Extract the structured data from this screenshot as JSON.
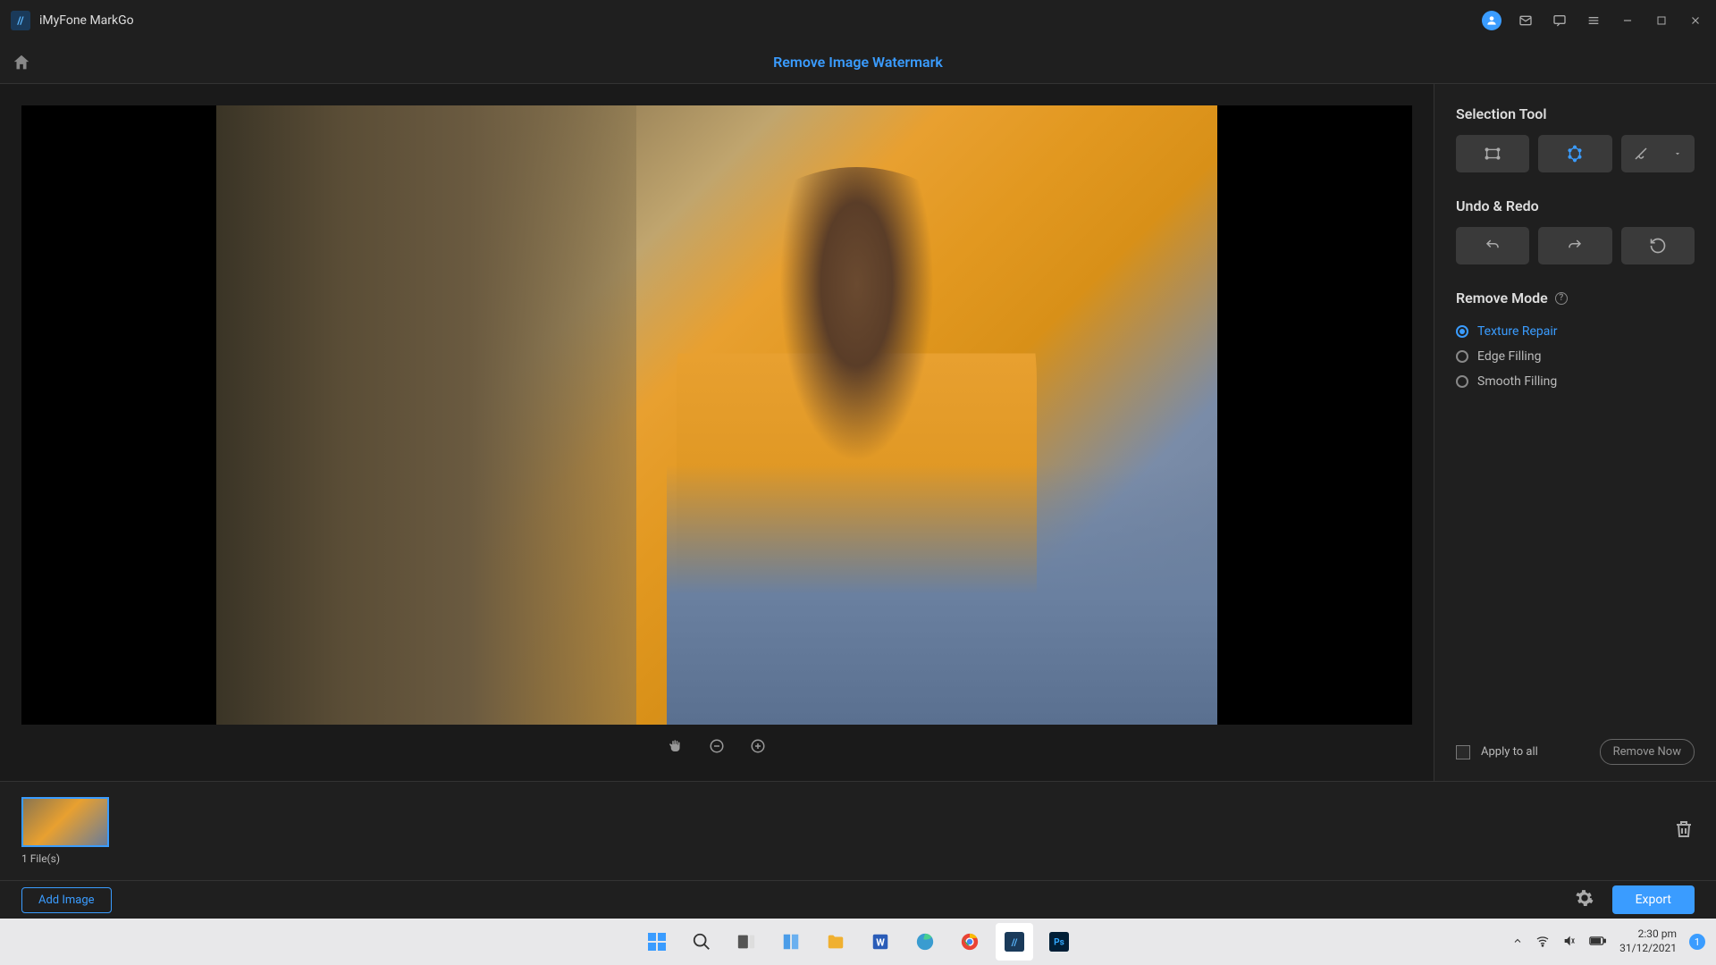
{
  "app": {
    "title": "iMyFone MarkGo"
  },
  "header": {
    "title": "Remove Image Watermark"
  },
  "panel": {
    "selection_title": "Selection Tool",
    "undo_title": "Undo & Redo",
    "remove_mode_title": "Remove Mode",
    "modes": [
      {
        "label": "Texture Repair",
        "active": true
      },
      {
        "label": "Edge Filling",
        "active": false
      },
      {
        "label": "Smooth Filling",
        "active": false
      }
    ],
    "apply_all": "Apply to all",
    "remove_now": "Remove Now"
  },
  "filmstrip": {
    "count": "1 File(s)"
  },
  "actions": {
    "add": "Add Image",
    "export": "Export"
  },
  "tray": {
    "time": "2:30 pm",
    "date": "31/12/2021",
    "notif": "1"
  }
}
